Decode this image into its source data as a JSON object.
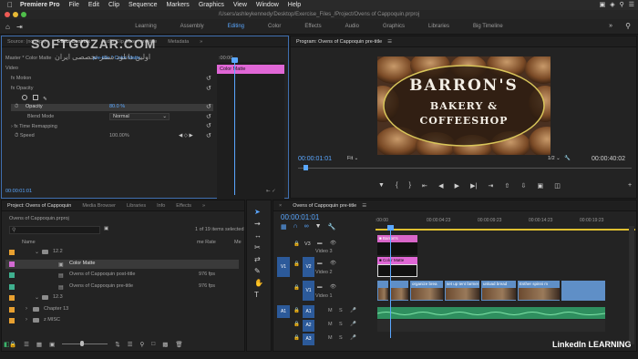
{
  "mac": {
    "apple": "",
    "app": "Premiere Pro",
    "menus": [
      "File",
      "Edit",
      "Clip",
      "Sequence",
      "Markers",
      "Graphics",
      "View",
      "Window",
      "Help"
    ]
  },
  "window": {
    "path": "/Users/ashleykennedy/Desktop/Exercise_Files_/Project/Ovens of Cappoquin.prproj"
  },
  "workspaces": [
    "Learning",
    "Assembly",
    "Editing",
    "Color",
    "Effects",
    "Audio",
    "Graphics",
    "Libraries",
    "Big Timeline"
  ],
  "active_workspace": "Editing",
  "watermark": {
    "line1": "SOFTGOZAR.COM",
    "line2": "اولین دانلود سنتر تخصصی ایران"
  },
  "effect_controls": {
    "tabs": [
      "Source: (no clips)",
      "Effect Controls",
      "Audio Clip Mixer: pre-title",
      "Metadata"
    ],
    "master": "Master * Color Matte",
    "seq_clip": "pre-title * Color Matte",
    "timecode_left": ":00:00",
    "video_label": "Video",
    "motion": "Motion",
    "opacity": "Opacity",
    "opacity_param": "Opacity",
    "opacity_value": "80.0 %",
    "blend_label": "Blend Mode",
    "blend_value": "Normal",
    "time_remap": "Time Remapping",
    "speed_label": "Speed",
    "speed_value": "100.00%",
    "clip_name": "Color Matte",
    "bottom_timecode": "00:00:01:01"
  },
  "program": {
    "title": "Program: Ovens of Cappoquin pre-title",
    "timecode": "00:00:01:01",
    "fit": "Fit",
    "page": "1/2",
    "duration": "00:00:40:02",
    "logo": {
      "line1": "BARRON'S",
      "line2": "BAKERY & COFFEESHOP"
    }
  },
  "project": {
    "tabs": [
      "Project: Ovens of Cappoquin",
      "Media Browser",
      "Libraries",
      "Info",
      "Effects"
    ],
    "file": "Ovens of Cappoquin.prproj",
    "count": "1 of 19 items selected",
    "col_name": "Name",
    "col_rate": "me Rate",
    "col_media": "Me",
    "items": [
      {
        "name": "12.2",
        "rate": "",
        "kind": "folder",
        "color": "#e8a030",
        "indent": 0
      },
      {
        "name": "Color Matte",
        "rate": "",
        "kind": "matte",
        "color": "#d36ad3",
        "indent": 1,
        "selected": true
      },
      {
        "name": "Ovens of Cappoquin post-title",
        "rate": "976 fps",
        "kind": "seq",
        "color": "#3fb08f",
        "indent": 1
      },
      {
        "name": "Ovens of Cappoquin pre-title",
        "rate": "976 fps",
        "kind": "seq",
        "color": "#3fb08f",
        "indent": 1
      },
      {
        "name": "12.3",
        "rate": "",
        "kind": "folder",
        "color": "#e8a030",
        "indent": 0
      },
      {
        "name": "Chapter 13",
        "rate": "",
        "kind": "folder",
        "color": "#e8a030",
        "indent": -1
      },
      {
        "name": "z MISC",
        "rate": "",
        "kind": "folder",
        "color": "#e8a030",
        "indent": -1
      }
    ]
  },
  "timeline": {
    "tab": "Ovens of Cappoquin pre-title",
    "timecode": "00:00:01:01",
    "ruler": [
      ":00:00",
      "00:00:04:23",
      "00:00:09:23",
      "00:00:14:23",
      "00:00:19:23"
    ],
    "tracks": {
      "v3": "V3",
      "v3_name": "Video 3",
      "v2": "V2",
      "v2_name": "Video 2",
      "v1": "V1",
      "v1_name": "Video 1",
      "a1": "A1",
      "a2": "A2",
      "a3": "A3",
      "src_v1": "V1",
      "src_a1": "A1"
    },
    "clips": {
      "v3": "Barron's",
      "v2": "Color Matte",
      "v1": [
        "",
        "",
        "organize brea",
        "set up tent farmer",
        "unload bread",
        "Esther spinni m"
      ]
    }
  },
  "branding": {
    "text": "LinkedIn LEARNING",
    "in": "in"
  },
  "colors": {
    "accent": "#5aa7ff",
    "matte": "#e067d6",
    "audio": "#3aa86b",
    "clip_blue": "#5f8fc7"
  }
}
